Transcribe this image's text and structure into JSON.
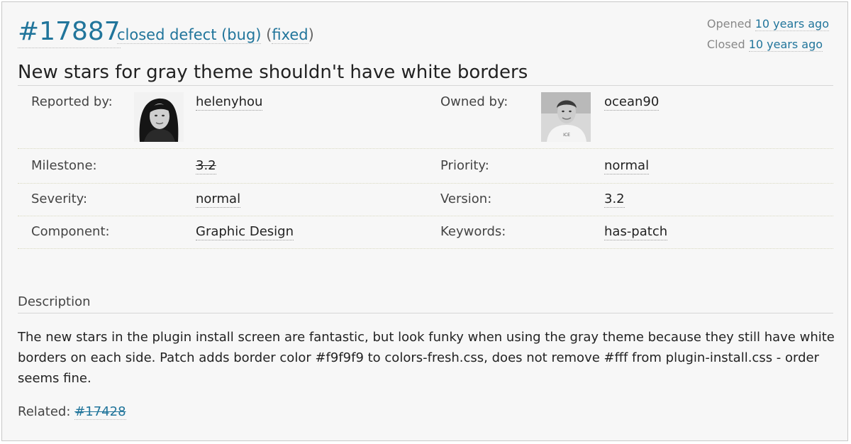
{
  "ticket": {
    "id": "#17887",
    "status": "closed defect (bug)",
    "paren_open": "(",
    "resolution": "fixed",
    "paren_close": ")",
    "opened_label": "Opened",
    "opened_value": "10 years ago",
    "closed_label": "Closed",
    "closed_value": "10 years ago",
    "summary": "New stars for gray theme shouldn't have white borders"
  },
  "props": {
    "reporter_label": "Reported by:",
    "reporter_value": "helenyhou",
    "owner_label": "Owned by:",
    "owner_value": "ocean90",
    "milestone_label": "Milestone:",
    "milestone_value": "3.2",
    "priority_label": "Priority:",
    "priority_value": "normal",
    "severity_label": "Severity:",
    "severity_value": "normal",
    "version_label": "Version:",
    "version_value": "3.2",
    "component_label": "Component:",
    "component_value": "Graphic Design",
    "keywords_label": "Keywords:",
    "keywords_value": "has-patch"
  },
  "description": {
    "heading": "Description",
    "body": "The new stars in the plugin install screen are fantastic, but look funky when using the gray theme because they still have white borders on each side. Patch adds border color #f9f9f9 to colors-fresh.css, does not remove #fff from plugin-install.css - order seems fine.",
    "related_label": "Related:",
    "related_link": "#17428"
  },
  "colors": {
    "link": "#21759b",
    "background": "#f7f7f7",
    "border": "#c8c8c8"
  }
}
